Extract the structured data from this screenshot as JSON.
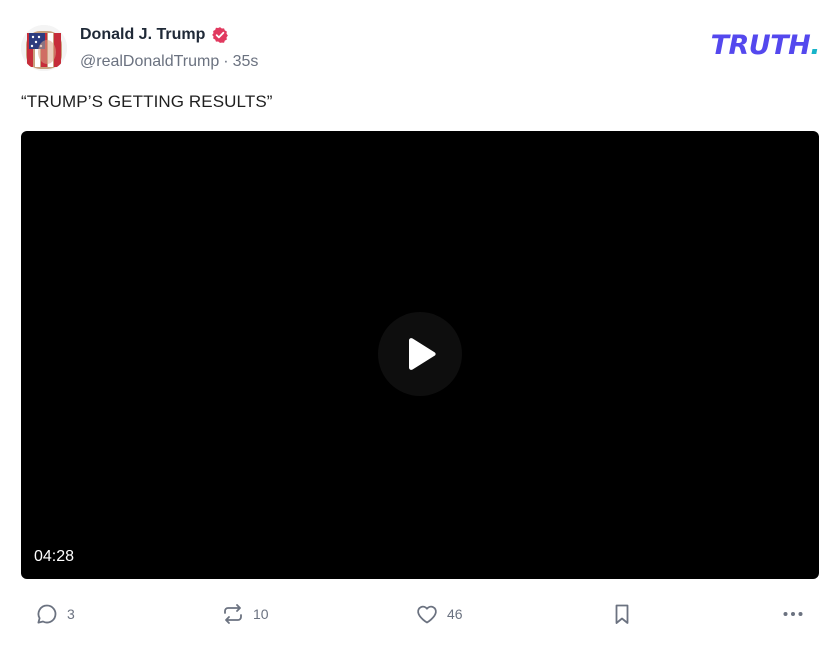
{
  "author": {
    "display_name": "Donald J. Trump",
    "handle": "@realDonaldTrump",
    "separator": "·",
    "time_ago": "35s",
    "verified_icon": "verified-badge-icon",
    "avatar_icon": "profile-avatar"
  },
  "brand": {
    "logo_text": "TRUTH",
    "logo_dot": ".",
    "logo_color": "#5448ee",
    "dot_color": "#17b4c9"
  },
  "post": {
    "text": "“TRUMP’S GETTING RESULTS”",
    "video": {
      "duration": "04:28",
      "play_icon": "play-icon",
      "background": "#000000"
    }
  },
  "actions": {
    "reply": {
      "icon": "reply-icon",
      "count": "3"
    },
    "repost": {
      "icon": "repost-icon",
      "count": "10"
    },
    "like": {
      "icon": "heart-icon",
      "count": "46"
    },
    "bookmark": {
      "icon": "bookmark-icon"
    },
    "more": {
      "icon": "more-icon"
    }
  },
  "colors": {
    "verified": "#e1395f",
    "muted_text": "#6b7280",
    "name_text": "#1f2937"
  }
}
